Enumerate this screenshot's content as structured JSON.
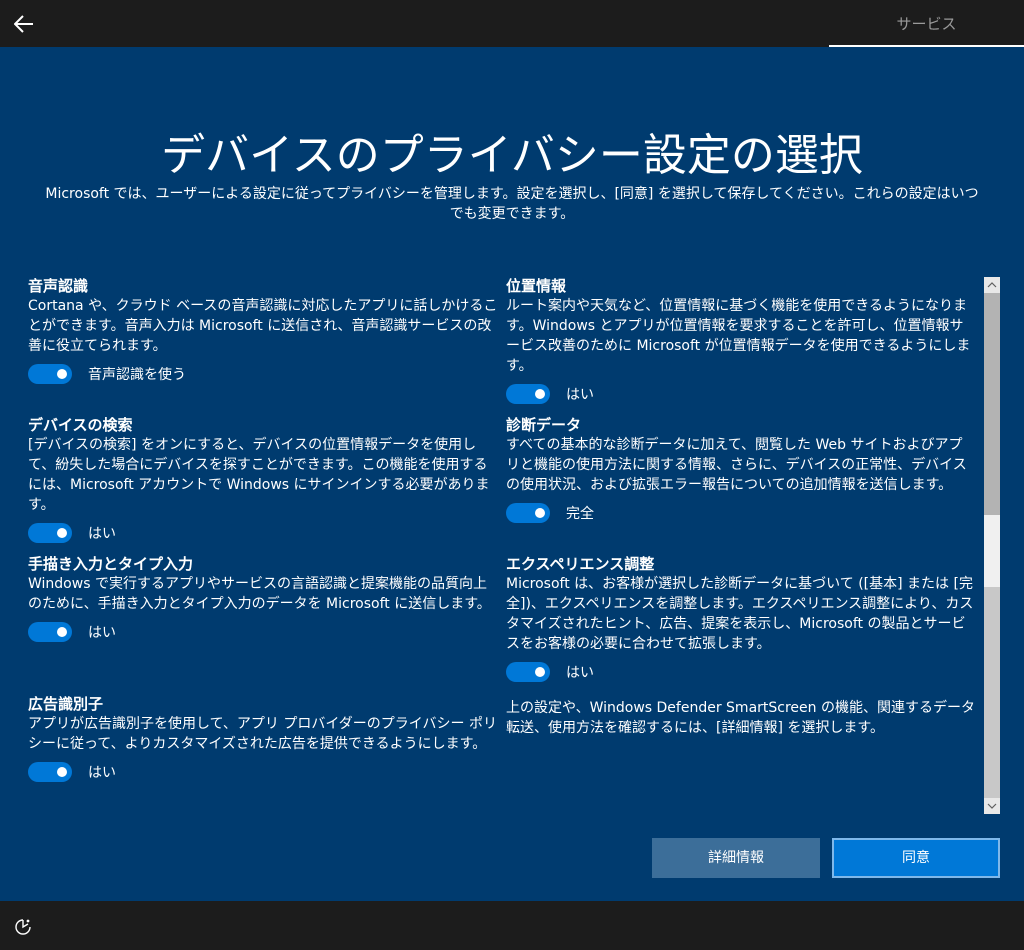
{
  "topbar": {
    "tab_label": "サービス"
  },
  "page": {
    "title": "デバイスのプライバシー設定の選択",
    "subtitle": "Microsoft では、ユーザーによる設定に従ってプライバシーを管理します。設定を選択し、[同意] を選択して保存してください。これらの設定はいつでも変更できます。"
  },
  "settings": {
    "speech": {
      "heading": "音声認識",
      "desc": "Cortana や、クラウド ベースの音声認識に対応したアプリに話しかけることができます。音声入力は Microsoft に送信され、音声認識サービスの改善に役立てられます。",
      "toggle_label": "音声認識を使う",
      "on": true
    },
    "find_device": {
      "heading": "デバイスの検索",
      "desc": "[デバイスの検索] をオンにすると、デバイスの位置情報データを使用して、紛失した場合にデバイスを探すことができます。この機能を使用するには、Microsoft アカウントで Windows にサインインする必要があります。",
      "toggle_label": "はい",
      "on": true
    },
    "inking": {
      "heading": "手描き入力とタイプ入力",
      "desc": "Windows で実行するアプリやサービスの言語認識と提案機能の品質向上のために、手描き入力とタイプ入力のデータを Microsoft に送信します。",
      "toggle_label": "はい",
      "on": true
    },
    "ad_id": {
      "heading": "広告識別子",
      "desc": "アプリが広告識別子を使用して、アプリ プロバイダーのプライバシー ポリシーに従って、よりカスタマイズされた広告を提供できるようにします。",
      "toggle_label": "はい",
      "on": true
    },
    "location": {
      "heading": "位置情報",
      "desc": "ルート案内や天気など、位置情報に基づく機能を使用できるようになります。Windows とアプリが位置情報を要求することを許可し、位置情報サービス改善のために Microsoft が位置情報データを使用できるようにします。",
      "toggle_label": "はい",
      "on": true
    },
    "diagnostics": {
      "heading": "診断データ",
      "desc": "すべての基本的な診断データに加えて、閲覧した Web サイトおよびアプリと機能の使用方法に関する情報、さらに、デバイスの正常性、デバイスの使用状況、および拡張エラー報告についての追加情報を送信します。",
      "toggle_label": "完全",
      "on": true
    },
    "experience": {
      "heading": "エクスペリエンス調整",
      "desc": "Microsoft は、お客様が選択した診断データに基づいて ([基本] または [完全])、エクスペリエンスを調整します。エクスペリエンス調整により、カスタマイズされたヒント、広告、提案を表示し、Microsoft の製品とサービスをお客様の必要に合わせて拡張します。",
      "toggle_label": "はい",
      "on": true
    }
  },
  "note": "上の設定や、Windows Defender SmartScreen の機能、関連するデータ転送、使用方法を確認するには、[詳細情報] を選択します。",
  "buttons": {
    "learn_more": "詳細情報",
    "accept": "同意"
  },
  "colors": {
    "background": "#003b6f",
    "accent": "#0078d7",
    "chrome": "#1c1c1c"
  }
}
